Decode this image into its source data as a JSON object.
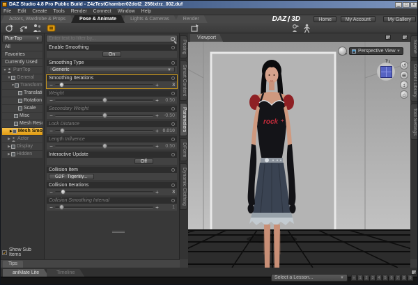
{
  "window": {
    "title": "DAZ Studio 4.8 Pro Public Build - Z4zTestChamber02dot2_256txtrz_002.duf",
    "controls": {
      "minimize": "_",
      "maximize": "□",
      "close": "×"
    }
  },
  "menu": {
    "items": [
      "File",
      "Edit",
      "Create",
      "Tools",
      "Render",
      "Connect",
      "Window",
      "Help"
    ]
  },
  "main_tabs": [
    "Actors, Wardrobe & Props",
    "Pose & Animate",
    "Lights & Cameras",
    "Render"
  ],
  "brand": {
    "left": "DAZ",
    "right": "3D"
  },
  "account_buttons": [
    "Home",
    "My Account",
    "My Gallery"
  ],
  "sidebar": {
    "scope_dropdown": "PurrTop",
    "list": [
      "All",
      "Favorites",
      "Currently Used"
    ],
    "tree": [
      "PurrTop",
      "General",
      "Transforms",
      "Translation",
      "Rotation",
      "Scale",
      "Misc",
      "Mesh Resolution",
      "Mesh Smoothing",
      "Actor",
      "Display",
      "Hidden"
    ],
    "show_sub_items": "Show Sub Items",
    "check": "✓",
    "tips_tab": "Tips"
  },
  "parameters": {
    "filter_placeholder": "Enter text to filter by...",
    "rows": [
      {
        "label": "Enable Smoothing",
        "value": "On"
      },
      {
        "label": "Smoothing Type",
        "value": "Generic"
      },
      {
        "label": "Smoothing Iterations",
        "value": "3"
      },
      {
        "label": "Weight",
        "value": "0.50"
      },
      {
        "label": "Secondary Weight",
        "value": "-0.50"
      },
      {
        "label": "Lock Distance",
        "value": "0.010"
      },
      {
        "label": "Length Influence",
        "value": "0.50"
      },
      {
        "label": "Interactive Update",
        "value": "Off"
      },
      {
        "label": "Collision Item",
        "value": "G2F_Tigerlily..."
      },
      {
        "label": "Collision Iterations",
        "value": "3"
      },
      {
        "label": "Collision Smoothing Interval",
        "value": "1"
      }
    ]
  },
  "side_tabs": [
    "Posing",
    "Smart Content",
    "Parameters",
    "DForm",
    "Dynamic Clothing"
  ],
  "right_tabs": [
    "Scene",
    "Content Library",
    "Tool Settings"
  ],
  "viewport": {
    "tab": "Viewport",
    "camera_dropdown": "Perspective View",
    "shirt_text": "rock",
    "accent_color": "#e09a10"
  },
  "animate": {
    "tabs": [
      "aniMate Lite",
      "Timeline"
    ]
  },
  "lessons": {
    "dropdown": "Select a Lesson...",
    "pager": [
      "«",
      "1",
      "2",
      "3",
      "4",
      "5",
      "6",
      "7",
      "8",
      "9"
    ]
  }
}
